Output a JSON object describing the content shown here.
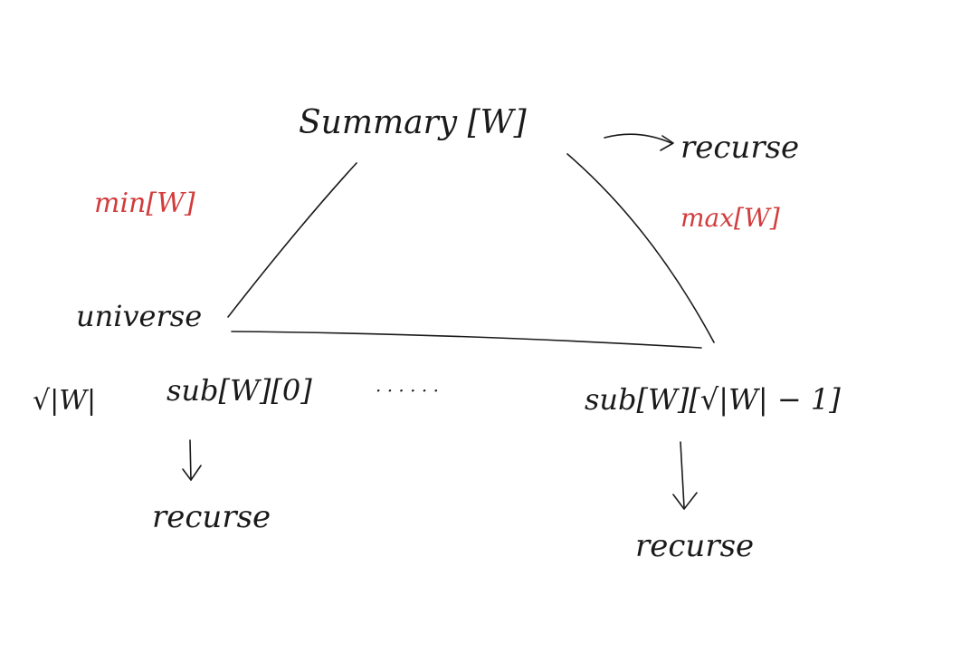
{
  "diagram": {
    "colors": {
      "ink": "#1a1a1a",
      "accent": "#d23c3c"
    },
    "summary_label": "Summary [W]",
    "summary_recurse_label": "recurse",
    "min_label": "min[W]",
    "max_label": "max[W]",
    "universe_label": "universe",
    "sqrt_label": "√|W|",
    "sub_first_label": "sub[W][0]",
    "ellipsis_label": "· · · · · ·",
    "sub_last_label": "sub[W][√|W| − 1]",
    "sub_first_recurse_label": "recurse",
    "sub_last_recurse_label": "recurse"
  }
}
